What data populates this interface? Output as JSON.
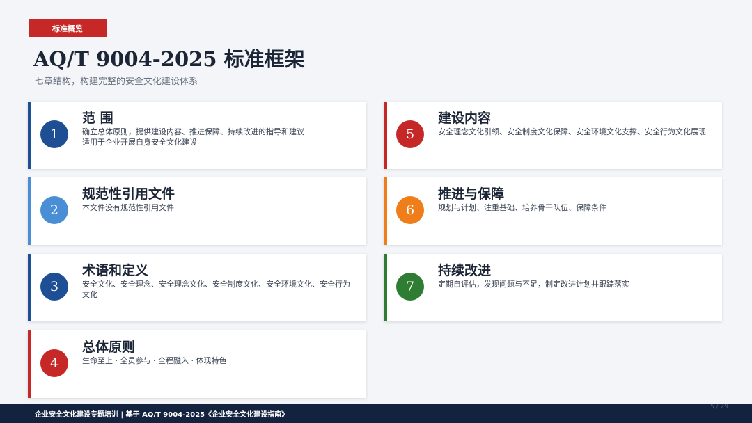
{
  "header": {
    "tag": "标准概览",
    "title": "AQ/T 9004-2025 标准框架",
    "subtitle": "七章结构，构建完整的安全文化建设体系"
  },
  "colors": {
    "blue_dark": "#1e4f95",
    "blue_light": "#4a8fd6",
    "red": "#c62828",
    "orange": "#ef7d1a",
    "green": "#2e7d32",
    "footer_bg": "#13233f"
  },
  "chapters": [
    {
      "num": "1",
      "title": "范  围",
      "desc": "确立总体原则，提供建设内容、推进保障、持续改进的指导和建议\n适用于企业开展自身安全文化建设"
    },
    {
      "num": "2",
      "title": "规范性引用文件",
      "desc": "本文件没有规范性引用文件"
    },
    {
      "num": "3",
      "title": "术语和定义",
      "desc": "安全文化、安全理念、安全理念文化、安全制度文化、安全环境文化、安全行为文化"
    },
    {
      "num": "4",
      "title": "总体原则",
      "desc": "生命至上 · 全员参与 · 全程融入 · 体现特色"
    },
    {
      "num": "5",
      "title": "建设内容",
      "desc": "安全理念文化引领、安全制度文化保障、安全环境文化支撑、安全行为文化展现"
    },
    {
      "num": "6",
      "title": "推进与保障",
      "desc": "规划与计划、注重基础、培养骨干队伍、保障条件"
    },
    {
      "num": "7",
      "title": "持续改进",
      "desc": "定期自评估，发现问题与不足，制定改进计划并跟踪落实"
    }
  ],
  "footer": {
    "text": "企业安全文化建设专题培训 | 基于 AQ/T 9004-2025《企业安全文化建设指南》",
    "page": "5 / 29"
  }
}
